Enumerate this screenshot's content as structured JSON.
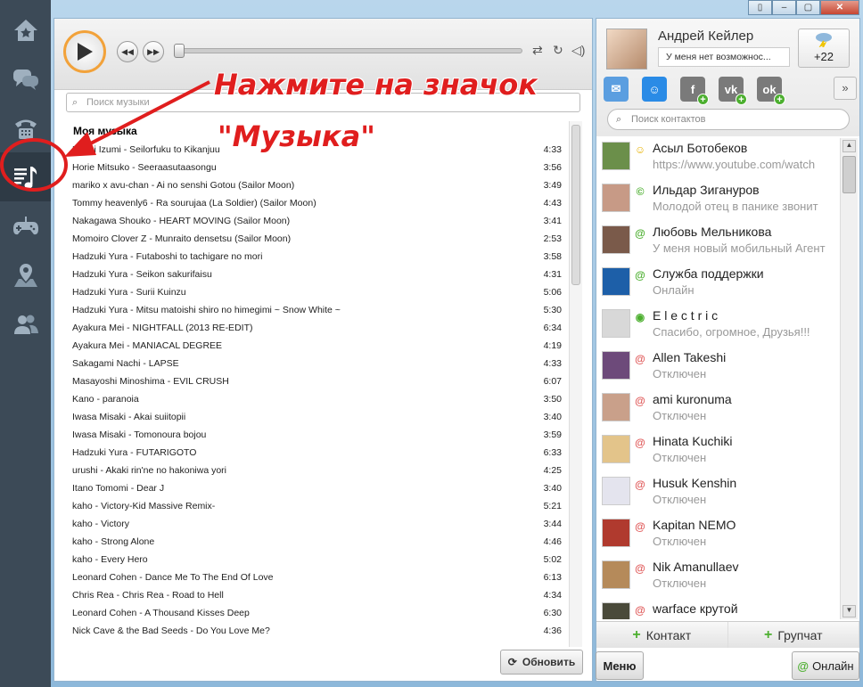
{
  "window": {
    "controls": [
      "▯",
      "–",
      "▢",
      "✕"
    ]
  },
  "rail": {
    "items": [
      "home-icon",
      "chat-icon",
      "phone-icon",
      "music-icon",
      "games-icon",
      "map-icon",
      "friends-icon"
    ]
  },
  "player": {
    "search_placeholder": "Поиск музыки",
    "list_title": "Моя музыка",
    "refresh_label": "Обновить",
    "tracks": [
      {
        "title": "Hoshi Izumi - Seilorfuku to Kikanjuu",
        "dur": "4:33"
      },
      {
        "title": "Horie Mitsuko - Seeraasutaasongu",
        "dur": "3:56"
      },
      {
        "title": "mariko x avu-chan - Ai no senshi Gotou (Sailor Moon)",
        "dur": "3:49"
      },
      {
        "title": "Tommy heavenly6 - Ra sourujaa (La Soldier) (Sailor Moon)",
        "dur": "4:43"
      },
      {
        "title": "Nakagawa Shouko - HEART MOVING (Sailor Moon)",
        "dur": "3:41"
      },
      {
        "title": "Momoiro Clover Z - Munraito densetsu (Sailor Moon)",
        "dur": "2:53"
      },
      {
        "title": "Hadzuki Yura - Futaboshi to tachigare no mori",
        "dur": "3:58"
      },
      {
        "title": "Hadzuki Yura - Seikon sakurifaisu",
        "dur": "4:31"
      },
      {
        "title": "Hadzuki Yura - Surii Kuinzu",
        "dur": "5:06"
      },
      {
        "title": "Hadzuki Yura - Mitsu matoishi shiro no himegimi ~ Snow White ~",
        "dur": "5:30"
      },
      {
        "title": "Ayakura Mei - NIGHTFALL (2013 RE-EDIT)",
        "dur": "6:34"
      },
      {
        "title": "Ayakura Mei - MANIACAL DEGREE",
        "dur": "4:19"
      },
      {
        "title": "Sakagami Nachi - LAPSE",
        "dur": "4:33"
      },
      {
        "title": "Masayoshi Minoshima - EVIL CRUSH",
        "dur": "6:07"
      },
      {
        "title": "Kano - paranoia",
        "dur": "3:50"
      },
      {
        "title": "Iwasa Misaki - Akai suiitopii",
        "dur": "3:40"
      },
      {
        "title": "Iwasa Misaki - Tomonoura bojou",
        "dur": "3:59"
      },
      {
        "title": "Hadzuki Yura - FUTARIGOTO",
        "dur": "6:33"
      },
      {
        "title": "urushi - Akaki rin'ne no hakoniwa yori",
        "dur": "4:25"
      },
      {
        "title": "Itano Tomomi - Dear J",
        "dur": "3:40"
      },
      {
        "title": "kaho - Victory-Kid Massive Remix-",
        "dur": "5:21"
      },
      {
        "title": "kaho - Victory",
        "dur": "3:44"
      },
      {
        "title": "kaho - Strong Alone",
        "dur": "4:46"
      },
      {
        "title": "kaho - Every Hero",
        "dur": "5:02"
      },
      {
        "title": "Leonard Cohen - Dance Me To The End Of Love",
        "dur": "6:13"
      },
      {
        "title": "Chris Rea - Chris Rea - Road to Hell",
        "dur": "4:34"
      },
      {
        "title": "Leonard Cohen - A Thousand Kisses Deep",
        "dur": "6:30"
      },
      {
        "title": "Nick Cave & the Bad Seeds - Do You Love Me?",
        "dur": "4:36"
      }
    ]
  },
  "annotation": {
    "line1": "Нажмите на значок",
    "line2": "\"Музыка\""
  },
  "profile": {
    "name": "Андрей Кейлер",
    "status": "У меня нет возможнос...",
    "weather": "+22",
    "networks": [
      "mail-icon",
      "moimir-icon",
      "facebook-icon",
      "vkontakte-icon",
      "odnoklassniki-icon"
    ],
    "more": "»",
    "search_placeholder": "Поиск контактов"
  },
  "contacts": [
    {
      "name": "Асыл Ботобеков",
      "status": "https://www.youtube.com/watch",
      "icon": "☺",
      "color": "#e8b200",
      "av": "#6b8f4a"
    },
    {
      "name": "Ильдар Зигануров",
      "status": "Молодой отец в панике звонит",
      "icon": "©",
      "color": "#4caf2f",
      "av": "#c79a86"
    },
    {
      "name": "Любовь Мельникова",
      "status": "У меня новый мобильный Агент",
      "icon": "@",
      "color": "#4caf2f",
      "av": "#7a5a4a"
    },
    {
      "name": "Служба поддержки",
      "status": "Онлайн",
      "icon": "@",
      "color": "#4caf2f",
      "av": "#1d5fa8"
    },
    {
      "name": "E l e c t r i c",
      "status": "Спасибо, огромное, Друзья!!!",
      "icon": "◉",
      "color": "#4caf2f",
      "av": "#d8d8d8"
    },
    {
      "name": "Allen Takeshi",
      "status": "Отключен",
      "icon": "@",
      "color": "#e05a5a",
      "av": "#6d4a7a"
    },
    {
      "name": "ami kuronuma",
      "status": "Отключен",
      "icon": "@",
      "color": "#e05a5a",
      "av": "#c9a08a"
    },
    {
      "name": "Hinata Kuchiki",
      "status": "Отключен",
      "icon": "@",
      "color": "#e05a5a",
      "av": "#e3c48a"
    },
    {
      "name": "Husuk Kenshin",
      "status": "Отключен",
      "icon": "@",
      "color": "#e05a5a",
      "av": "#e4e4ee"
    },
    {
      "name": "Kapitan NEMO",
      "status": "Отключен",
      "icon": "@",
      "color": "#e05a5a",
      "av": "#b03a2e"
    },
    {
      "name": "Nik Amanullaev",
      "status": "Отключен",
      "icon": "@",
      "color": "#e05a5a",
      "av": "#b58a5a"
    },
    {
      "name": "warface крутой",
      "status": "",
      "icon": "@",
      "color": "#e05a5a",
      "av": "#4a4a3a"
    }
  ],
  "footer": {
    "add_contact": "Контакт",
    "group_chat": "Групчат",
    "menu": "Меню",
    "online": "Онлайн"
  }
}
